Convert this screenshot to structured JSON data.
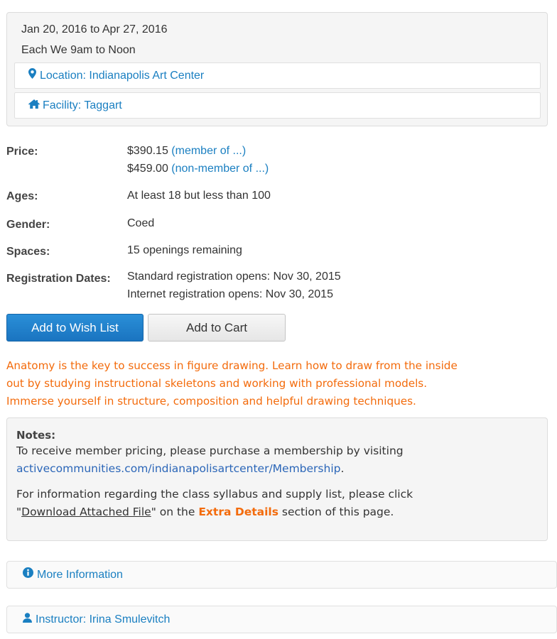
{
  "schedule": {
    "date_range": "Jan 20, 2016 to Apr 27, 2016",
    "time": "Each We 9am to Noon",
    "location_label": "Location: Indianapolis Art Center",
    "facility_label": "Facility: Taggart",
    "location_icon": "map-marker-icon",
    "facility_icon": "home-icon"
  },
  "details": {
    "price_label": "Price:",
    "price_member_amount": "$390.15",
    "price_member_link": "(member of ...)",
    "price_nonmember_amount": "$459.00",
    "price_nonmember_link": "(non-member of ...)",
    "ages_label": "Ages:",
    "ages_value": "At least 18 but less than 100",
    "gender_label": "Gender:",
    "gender_value": "Coed",
    "spaces_label": "Spaces:",
    "spaces_value": "15 openings remaining",
    "registration_label": "Registration Dates:",
    "registration_standard": "Standard registration opens: Nov 30, 2015",
    "registration_internet": "Internet registration opens: Nov 30, 2015"
  },
  "buttons": {
    "wish_list": "Add to Wish List",
    "cart": "Add to Cart"
  },
  "description": {
    "line1": "Anatomy is the key to success in figure drawing. Learn how to draw from the inside",
    "line2": "out by studying instructional skeletons and working with professional models.",
    "line3": "Immerse yourself in structure, composition and helpful drawing techniques."
  },
  "notes": {
    "title": "Notes:",
    "p1_text": "To receive member pricing, please purchase a membership by visiting",
    "p1_link": "activecommunities.com/indianapolisartcenter/Membership",
    "p1_end": ".",
    "p2_text": "For information regarding the class syllabus and supply list, please click",
    "p2_quote_open": "\"",
    "p2_link": "Download Attached File",
    "p2_middle": "\" on the ",
    "p2_highlight": "Extra Details",
    "p2_end": " section of this page."
  },
  "panels": {
    "more_info": "More Information",
    "more_info_icon": "info-circle-icon",
    "instructor": "Instructor: Irina Smulevitch",
    "instructor_icon": "user-icon"
  },
  "colors": {
    "link": "#1a7fc1",
    "accent_orange": "#f36b0c",
    "primary_button": "#1a74c0"
  }
}
